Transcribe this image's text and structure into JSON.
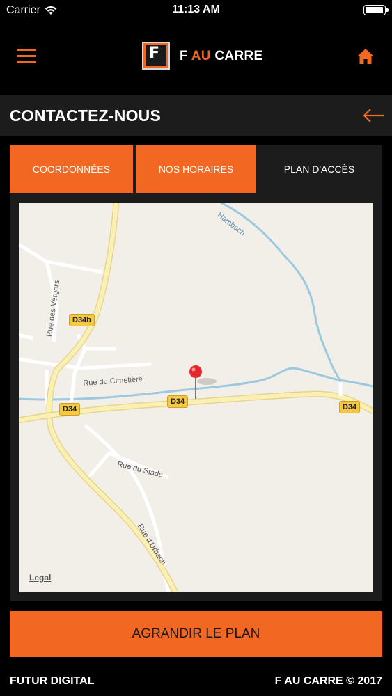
{
  "status_bar": {
    "carrier": "Carrier",
    "time": "11:13 AM",
    "battery_level": 1.0
  },
  "header": {
    "brand_prefix": "F ",
    "brand_accent": "AU",
    "brand_suffix": " CARRE",
    "logo_letter": "F",
    "accent_color": "#f26722"
  },
  "title_bar": {
    "title": "CONTACTEZ-NOUS"
  },
  "tabs": [
    {
      "label": "COORDONNÉES",
      "active": true
    },
    {
      "label": "NOS HORAIRES",
      "active": true
    },
    {
      "label": "PLAN D'ACCÈS",
      "active": false
    }
  ],
  "map": {
    "labels": {
      "hambach": "Hambach",
      "rue_des_vergers": "Rue des Vergers",
      "rue_du_cimetiere": "Rue du Cimetière",
      "rue_du_stade": "Rue du Stade",
      "rue_durbach": "Rue d'Urbach"
    },
    "road_shields": {
      "d34b": "D34b",
      "d34_left": "D34",
      "d34_center": "D34",
      "d34_right": "D34"
    },
    "legal": "Legal"
  },
  "enlarge_button": "AGRANDIR LE PLAN",
  "footer": {
    "left": "FUTUR DIGITAL",
    "right": "F AU CARRE © 2017"
  }
}
